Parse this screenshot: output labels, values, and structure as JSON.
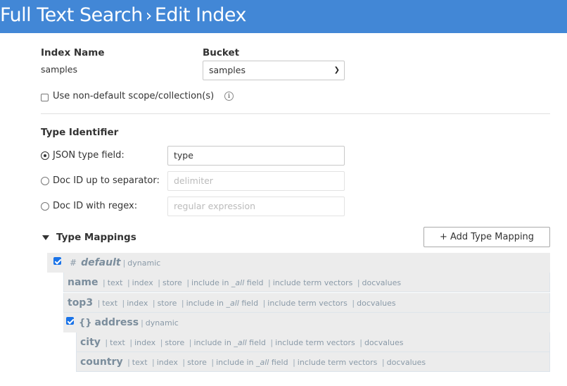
{
  "header": {
    "breadcrumb_parent": "Full Text Search",
    "separator": "›",
    "title": "Edit Index"
  },
  "index_name": {
    "label": "Index Name",
    "value": "samples"
  },
  "bucket": {
    "label": "Bucket",
    "selected": "samples",
    "chevron_icon": "chevron-down-icon"
  },
  "scope_option": {
    "label": "Use non-default scope/collection(s)",
    "checked": false,
    "info_icon": "i"
  },
  "type_identifier": {
    "heading": "Type Identifier",
    "options": [
      {
        "label": "JSON type field:",
        "selected": true,
        "value": "type",
        "placeholder": ""
      },
      {
        "label": "Doc ID up to separator:",
        "selected": false,
        "value": "",
        "placeholder": "delimiter"
      },
      {
        "label": "Doc ID with regex:",
        "selected": false,
        "value": "",
        "placeholder": "regular expression"
      }
    ]
  },
  "type_mappings": {
    "heading": "Type Mappings",
    "add_button": "+ Add Type Mapping",
    "default_mapping": {
      "icon": "#",
      "name": "default",
      "mode": "dynamic",
      "checked": true
    },
    "fields": [
      {
        "name": "name",
        "attrs": [
          "text",
          "index",
          "store",
          "include in",
          "_all",
          "field",
          "include term vectors",
          "docvalues"
        ]
      },
      {
        "name": "top3",
        "attrs": [
          "text",
          "index",
          "store",
          "include in",
          "_all",
          "field",
          "include term vectors",
          "docvalues"
        ]
      }
    ],
    "child_mapping": {
      "icon": "{}",
      "name": "address",
      "mode": "dynamic",
      "checked": true,
      "fields": [
        {
          "name": "city"
        },
        {
          "name": "country"
        }
      ]
    },
    "attr_labels": {
      "text": "text",
      "index": "index",
      "store": "store",
      "include_in": "include in ",
      "all": "_all",
      "field": " field",
      "term_vectors": "include term vectors",
      "docvalues": "docvalues",
      "pipe": "|"
    }
  }
}
